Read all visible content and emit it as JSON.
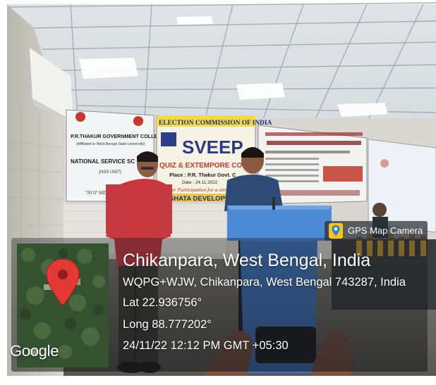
{
  "badge": {
    "label": "GPS Map Camera",
    "icon": "map-pin-app-icon"
  },
  "location": {
    "title": "Chikanpara, West Bengal, India",
    "address": "WQPG+WJW, Chikanpara, West Bengal 743287, India",
    "latitude": "Lat 22.936756°",
    "longitude": "Long 88.777202°",
    "datetime": "24/11/22 12:12 PM GMT +05:30"
  },
  "map": {
    "brand": "Google",
    "pin_color": "#e53935"
  },
  "photo": {
    "banner_left": {
      "line1": "P.R.THAKUR GOVERNMENT COLLEGE",
      "line2": "(Affiliated to West Bengal State University)",
      "line3": "NATIONAL SERVICE SC",
      "line4": "(NSS UNIT)",
      "line5": "\"NOT ME BU"
    },
    "banner_center": {
      "line1": "ELECTION COMMISSION OF INDIA",
      "line2": "SVEEP",
      "line3": "QUIZ & EXTEMPORE COMPETI",
      "line4": "Place : P.R. Thakur Govt. C",
      "line5": "Date : 24.11.2022",
      "line6": "Greater Participation for a stro",
      "line7": "NGHATA DEVELOPM"
    }
  }
}
